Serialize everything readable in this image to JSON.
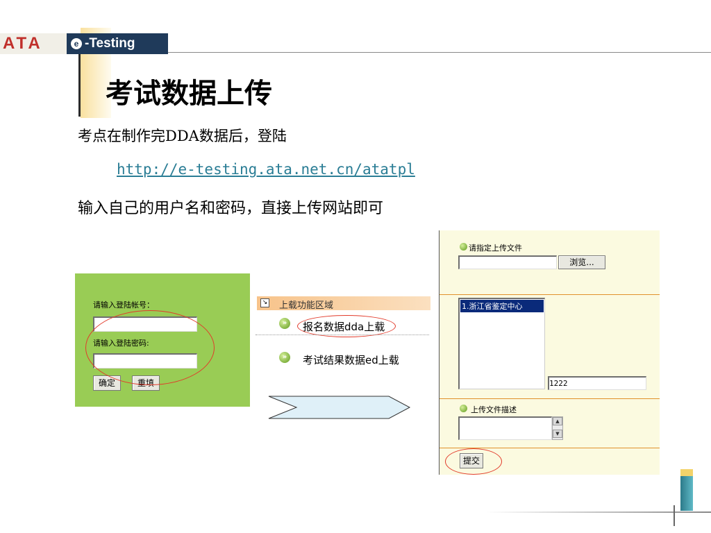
{
  "header": {
    "logo_ata": "ATA",
    "logo_etesting": "-Testing",
    "logo_badge": "e"
  },
  "slide": {
    "title": "考试数据上传",
    "line1": "考点在制作完DDA数据后，登陆",
    "link": "http://e-testing.ata.net.cn/atatpl",
    "line3": "输入自己的用户名和密码，直接上传网站即可"
  },
  "login_panel": {
    "account_label": "请输入登陆帐号：",
    "account_value": "",
    "password_label": "请输入登陆密码:",
    "password_value": "",
    "confirm_button": "确定",
    "reset_button": "重填"
  },
  "upload_area": {
    "header_label": "上载功能区域",
    "header_checkbox": "↘",
    "items": [
      {
        "label": "报名数据dda上载"
      },
      {
        "label": "考试结果数据ed上载"
      }
    ]
  },
  "upload_form": {
    "file_label": "请指定上传文件",
    "file_value": "",
    "browse_button": "浏览...",
    "center_options": [
      "1.浙江省鉴定中心"
    ],
    "code_value": "1222",
    "desc_label": "上传文件描述",
    "desc_value": "",
    "submit_button": "提交"
  },
  "colors": {
    "login_bg": "#99cc55",
    "form_bg": "#fbfae0",
    "accent_orange": "#e0902a",
    "link": "#2a7d95",
    "ellipse_red": "#e23a2a"
  }
}
